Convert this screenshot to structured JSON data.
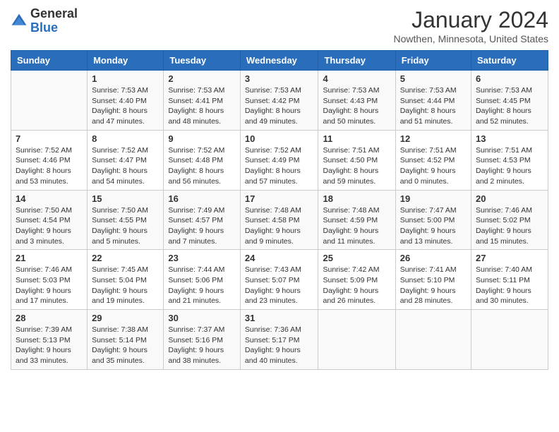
{
  "header": {
    "logo_general": "General",
    "logo_blue": "Blue",
    "month_title": "January 2024",
    "location": "Nowthen, Minnesota, United States"
  },
  "days_of_week": [
    "Sunday",
    "Monday",
    "Tuesday",
    "Wednesday",
    "Thursday",
    "Friday",
    "Saturday"
  ],
  "weeks": [
    [
      {
        "day": "",
        "sunrise": "",
        "sunset": "",
        "daylight": ""
      },
      {
        "day": "1",
        "sunrise": "Sunrise: 7:53 AM",
        "sunset": "Sunset: 4:40 PM",
        "daylight": "Daylight: 8 hours and 47 minutes."
      },
      {
        "day": "2",
        "sunrise": "Sunrise: 7:53 AM",
        "sunset": "Sunset: 4:41 PM",
        "daylight": "Daylight: 8 hours and 48 minutes."
      },
      {
        "day": "3",
        "sunrise": "Sunrise: 7:53 AM",
        "sunset": "Sunset: 4:42 PM",
        "daylight": "Daylight: 8 hours and 49 minutes."
      },
      {
        "day": "4",
        "sunrise": "Sunrise: 7:53 AM",
        "sunset": "Sunset: 4:43 PM",
        "daylight": "Daylight: 8 hours and 50 minutes."
      },
      {
        "day": "5",
        "sunrise": "Sunrise: 7:53 AM",
        "sunset": "Sunset: 4:44 PM",
        "daylight": "Daylight: 8 hours and 51 minutes."
      },
      {
        "day": "6",
        "sunrise": "Sunrise: 7:53 AM",
        "sunset": "Sunset: 4:45 PM",
        "daylight": "Daylight: 8 hours and 52 minutes."
      }
    ],
    [
      {
        "day": "7",
        "sunrise": "Sunrise: 7:52 AM",
        "sunset": "Sunset: 4:46 PM",
        "daylight": "Daylight: 8 hours and 53 minutes."
      },
      {
        "day": "8",
        "sunrise": "Sunrise: 7:52 AM",
        "sunset": "Sunset: 4:47 PM",
        "daylight": "Daylight: 8 hours and 54 minutes."
      },
      {
        "day": "9",
        "sunrise": "Sunrise: 7:52 AM",
        "sunset": "Sunset: 4:48 PM",
        "daylight": "Daylight: 8 hours and 56 minutes."
      },
      {
        "day": "10",
        "sunrise": "Sunrise: 7:52 AM",
        "sunset": "Sunset: 4:49 PM",
        "daylight": "Daylight: 8 hours and 57 minutes."
      },
      {
        "day": "11",
        "sunrise": "Sunrise: 7:51 AM",
        "sunset": "Sunset: 4:50 PM",
        "daylight": "Daylight: 8 hours and 59 minutes."
      },
      {
        "day": "12",
        "sunrise": "Sunrise: 7:51 AM",
        "sunset": "Sunset: 4:52 PM",
        "daylight": "Daylight: 9 hours and 0 minutes."
      },
      {
        "day": "13",
        "sunrise": "Sunrise: 7:51 AM",
        "sunset": "Sunset: 4:53 PM",
        "daylight": "Daylight: 9 hours and 2 minutes."
      }
    ],
    [
      {
        "day": "14",
        "sunrise": "Sunrise: 7:50 AM",
        "sunset": "Sunset: 4:54 PM",
        "daylight": "Daylight: 9 hours and 3 minutes."
      },
      {
        "day": "15",
        "sunrise": "Sunrise: 7:50 AM",
        "sunset": "Sunset: 4:55 PM",
        "daylight": "Daylight: 9 hours and 5 minutes."
      },
      {
        "day": "16",
        "sunrise": "Sunrise: 7:49 AM",
        "sunset": "Sunset: 4:57 PM",
        "daylight": "Daylight: 9 hours and 7 minutes."
      },
      {
        "day": "17",
        "sunrise": "Sunrise: 7:48 AM",
        "sunset": "Sunset: 4:58 PM",
        "daylight": "Daylight: 9 hours and 9 minutes."
      },
      {
        "day": "18",
        "sunrise": "Sunrise: 7:48 AM",
        "sunset": "Sunset: 4:59 PM",
        "daylight": "Daylight: 9 hours and 11 minutes."
      },
      {
        "day": "19",
        "sunrise": "Sunrise: 7:47 AM",
        "sunset": "Sunset: 5:00 PM",
        "daylight": "Daylight: 9 hours and 13 minutes."
      },
      {
        "day": "20",
        "sunrise": "Sunrise: 7:46 AM",
        "sunset": "Sunset: 5:02 PM",
        "daylight": "Daylight: 9 hours and 15 minutes."
      }
    ],
    [
      {
        "day": "21",
        "sunrise": "Sunrise: 7:46 AM",
        "sunset": "Sunset: 5:03 PM",
        "daylight": "Daylight: 9 hours and 17 minutes."
      },
      {
        "day": "22",
        "sunrise": "Sunrise: 7:45 AM",
        "sunset": "Sunset: 5:04 PM",
        "daylight": "Daylight: 9 hours and 19 minutes."
      },
      {
        "day": "23",
        "sunrise": "Sunrise: 7:44 AM",
        "sunset": "Sunset: 5:06 PM",
        "daylight": "Daylight: 9 hours and 21 minutes."
      },
      {
        "day": "24",
        "sunrise": "Sunrise: 7:43 AM",
        "sunset": "Sunset: 5:07 PM",
        "daylight": "Daylight: 9 hours and 23 minutes."
      },
      {
        "day": "25",
        "sunrise": "Sunrise: 7:42 AM",
        "sunset": "Sunset: 5:09 PM",
        "daylight": "Daylight: 9 hours and 26 minutes."
      },
      {
        "day": "26",
        "sunrise": "Sunrise: 7:41 AM",
        "sunset": "Sunset: 5:10 PM",
        "daylight": "Daylight: 9 hours and 28 minutes."
      },
      {
        "day": "27",
        "sunrise": "Sunrise: 7:40 AM",
        "sunset": "Sunset: 5:11 PM",
        "daylight": "Daylight: 9 hours and 30 minutes."
      }
    ],
    [
      {
        "day": "28",
        "sunrise": "Sunrise: 7:39 AM",
        "sunset": "Sunset: 5:13 PM",
        "daylight": "Daylight: 9 hours and 33 minutes."
      },
      {
        "day": "29",
        "sunrise": "Sunrise: 7:38 AM",
        "sunset": "Sunset: 5:14 PM",
        "daylight": "Daylight: 9 hours and 35 minutes."
      },
      {
        "day": "30",
        "sunrise": "Sunrise: 7:37 AM",
        "sunset": "Sunset: 5:16 PM",
        "daylight": "Daylight: 9 hours and 38 minutes."
      },
      {
        "day": "31",
        "sunrise": "Sunrise: 7:36 AM",
        "sunset": "Sunset: 5:17 PM",
        "daylight": "Daylight: 9 hours and 40 minutes."
      },
      {
        "day": "",
        "sunrise": "",
        "sunset": "",
        "daylight": ""
      },
      {
        "day": "",
        "sunrise": "",
        "sunset": "",
        "daylight": ""
      },
      {
        "day": "",
        "sunrise": "",
        "sunset": "",
        "daylight": ""
      }
    ]
  ],
  "colors": {
    "header_bg": "#2a6ebb",
    "accent": "#2a6ebb"
  }
}
